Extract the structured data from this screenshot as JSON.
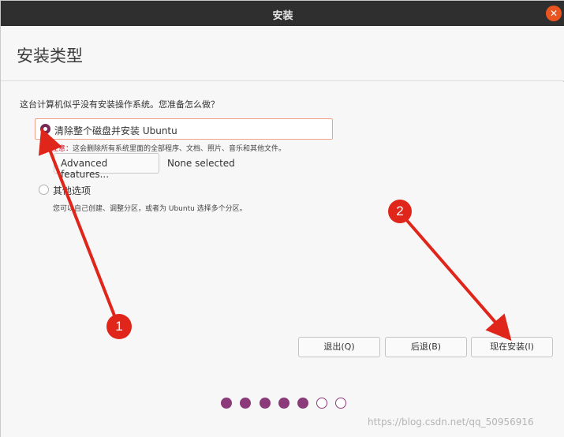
{
  "window": {
    "title": "安装",
    "close_icon": "close-icon"
  },
  "header": {
    "title": "安装类型"
  },
  "main": {
    "question": "这台计算机似乎没有安装操作系统。您准备怎么做？",
    "option_erase": {
      "label": "清除整个磁盘并安装 Ubuntu",
      "selected": true,
      "note_prefix": "注意：",
      "note": "这会删除所有系统里面的全部程序、文档、照片、音乐和其他文件。",
      "advanced_button": "Advanced features...",
      "advanced_status": "None selected"
    },
    "option_other": {
      "label": "其他选项",
      "selected": false,
      "note": "您可以自己创建、调整分区，或者为 Ubuntu 选择多个分区。"
    }
  },
  "buttons": {
    "quit": "退出(Q)",
    "back": "后退(B)",
    "install_now": "现在安装(I)"
  },
  "progress": {
    "steps_total": 7,
    "steps_completed": 5,
    "accent_color": "#8b3b7a"
  },
  "annotations": {
    "marker_1": "1",
    "marker_2": "2",
    "color": "#e0251b"
  },
  "watermark": "https://blog.csdn.net/qq_50956916"
}
